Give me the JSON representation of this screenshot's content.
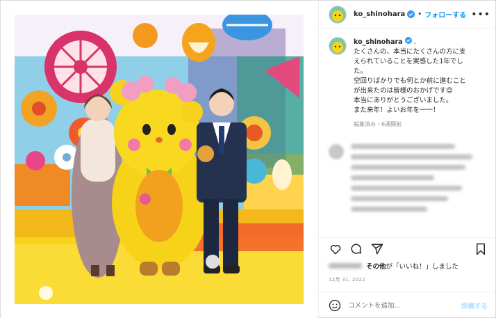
{
  "post": {
    "username": "ko_shinohara",
    "separator": "•",
    "follow_label": "フォローする",
    "more_label": "•••",
    "caption_suffix": ".",
    "caption_lines": [
      "たくさんの、本当にたくさんの方に支",
      "えられていることを実感した1年でし",
      "た。",
      "空回りばかりでも何とか前に進むこと",
      "が出来たのは皆様のおかげです😊",
      "本当にありがとうございました。",
      "また来年！よいお年を一一！"
    ],
    "caption_meta": "編集済み・6週間前",
    "likes_text_mid": "その他",
    "likes_text_rest": "が「いいね！」しました",
    "date": "12月 31, 2022",
    "comment_placeholder": "コメントを追加...",
    "post_button": "投稿する"
  },
  "colors": {
    "accent": "#0095f6",
    "verified": "#3897f0",
    "post_disabled": "#b2dffc",
    "muted": "#8e8e8e"
  },
  "icons": [
    "verified-badge-icon",
    "more-options-icon",
    "heart-icon",
    "comment-icon",
    "share-icon",
    "bookmark-icon",
    "emoji-icon"
  ]
}
